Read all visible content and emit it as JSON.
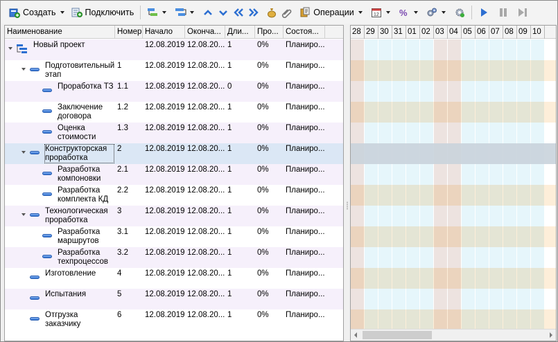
{
  "toolbar": {
    "create_label": "Создать",
    "connect_label": "Подключить",
    "operations_label": "Операции"
  },
  "columns": [
    "Наименование",
    "Номер",
    "Начало",
    "Оконча...",
    "Дли...",
    "Про...",
    "Состоя..."
  ],
  "tasks": [
    {
      "name": "Новый проект",
      "num": "",
      "start": "12.08.2019",
      "end": "12.08.20...",
      "dur": "1",
      "prog": "0%",
      "state": "Планиро..."
    },
    {
      "name": "Подготовительный этап",
      "num": "1",
      "start": "12.08.2019",
      "end": "12.08.20...",
      "dur": "1",
      "prog": "0%",
      "state": "Планиро..."
    },
    {
      "name": "Проработка ТЗ",
      "num": "1.1",
      "start": "12.08.2019",
      "end": "12.08.20...",
      "dur": "0",
      "prog": "0%",
      "state": "Планиро..."
    },
    {
      "name": "Заключение договора",
      "num": "1.2",
      "start": "12.08.2019",
      "end": "12.08.20...",
      "dur": "1",
      "prog": "0%",
      "state": "Планиро..."
    },
    {
      "name": "Оценка стоимости",
      "num": "1.3",
      "start": "12.08.2019",
      "end": "12.08.20...",
      "dur": "1",
      "prog": "0%",
      "state": "Планиро..."
    },
    {
      "name": "Конструкторская проработка",
      "num": "2",
      "start": "12.08.2019",
      "end": "12.08.20...",
      "dur": "1",
      "prog": "0%",
      "state": "Планиро..."
    },
    {
      "name": "Разработка компоновки",
      "num": "2.1",
      "start": "12.08.2019",
      "end": "12.08.20...",
      "dur": "1",
      "prog": "0%",
      "state": "Планиро..."
    },
    {
      "name": "Разработка комплекта КД",
      "num": "2.2",
      "start": "12.08.2019",
      "end": "12.08.20...",
      "dur": "1",
      "prog": "0%",
      "state": "Планиро..."
    },
    {
      "name": "Технологическая проработка",
      "num": "3",
      "start": "12.08.2019",
      "end": "12.08.20...",
      "dur": "1",
      "prog": "0%",
      "state": "Планиро..."
    },
    {
      "name": "Разработка маршрутов",
      "num": "3.1",
      "start": "12.08.2019",
      "end": "12.08.20...",
      "dur": "1",
      "prog": "0%",
      "state": "Планиро..."
    },
    {
      "name": "Разработка техпроцессов",
      "num": "3.2",
      "start": "12.08.2019",
      "end": "12.08.20...",
      "dur": "1",
      "prog": "0%",
      "state": "Планиро..."
    },
    {
      "name": "Изготовление",
      "num": "4",
      "start": "12.08.2019",
      "end": "12.08.20...",
      "dur": "1",
      "prog": "0%",
      "state": "Планиро..."
    },
    {
      "name": "Испытания",
      "num": "5",
      "start": "12.08.2019",
      "end": "12.08.20...",
      "dur": "1",
      "prog": "0%",
      "state": "Планиро..."
    },
    {
      "name": "Отгрузка заказчику",
      "num": "6",
      "start": "12.08.2019",
      "end": "12.08.20...",
      "dur": "1",
      "prog": "0%",
      "state": "Планиро..."
    }
  ],
  "gantt_days": [
    "28",
    "29",
    "30",
    "31",
    "01",
    "02",
    "03",
    "04",
    "05",
    "06",
    "07",
    "08",
    "09",
    "10"
  ],
  "colors": {
    "weekend_column": "#ede3e0",
    "weekday_column": "#e6f6fb",
    "odd_row_tint": "#fde9cd",
    "selected_row": "#c9d3dc",
    "accent_blue": "#2d6fd1"
  }
}
